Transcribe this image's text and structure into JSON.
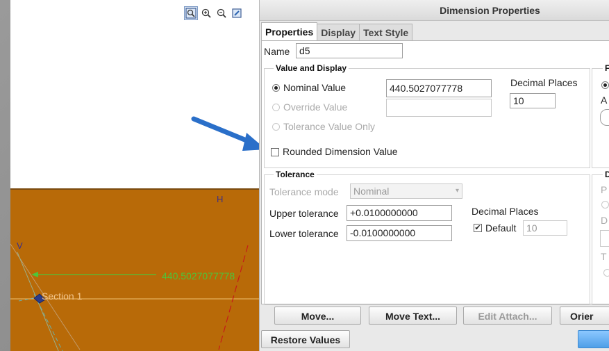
{
  "graphics": {
    "toolbar": [
      {
        "name": "zoom-fit-icon",
        "active": true
      },
      {
        "name": "zoom-in-icon"
      },
      {
        "name": "zoom-out-icon"
      },
      {
        "name": "repaint-icon"
      }
    ],
    "labels": {
      "h": "H",
      "v": "V",
      "dimension": "440.5027077778",
      "section": "Section 1"
    }
  },
  "dialog": {
    "title": "Dimension Properties",
    "tabs": [
      "Properties",
      "Display",
      "Text Style"
    ],
    "name_label": "Name",
    "name_value": "d5",
    "value_display": {
      "group_label": "Value and Display",
      "nominal_label": "Nominal Value",
      "nominal_value": "440.5027077778",
      "override_label": "Override Value",
      "override_value": "",
      "tolerance_only_label": "Tolerance Value Only",
      "rounded_label": "Rounded Dimension Value",
      "decimal_places_label": "Decimal Places",
      "decimal_places_value": "10"
    },
    "right_clipped": {
      "top_group_letter": "F",
      "top_a": "A",
      "bottom_group_letter": "D",
      "bottom_p": "P",
      "bottom_d": "D",
      "bottom_t": "T"
    },
    "tolerance": {
      "group_label": "Tolerance",
      "mode_label": "Tolerance mode",
      "mode_value": "Nominal",
      "upper_label": "Upper tolerance",
      "upper_value": "+0.0100000000",
      "lower_label": "Lower tolerance",
      "lower_value": "-0.0100000000",
      "decimal_places_label": "Decimal Places",
      "default_label": "Default",
      "default_value": "10"
    },
    "buttons": {
      "move": "Move...",
      "move_text": "Move Text...",
      "edit_attach": "Edit Attach...",
      "orient": "Orier",
      "restore": "Restore Values"
    }
  },
  "annotation": {
    "color": "#2a6fc9"
  }
}
